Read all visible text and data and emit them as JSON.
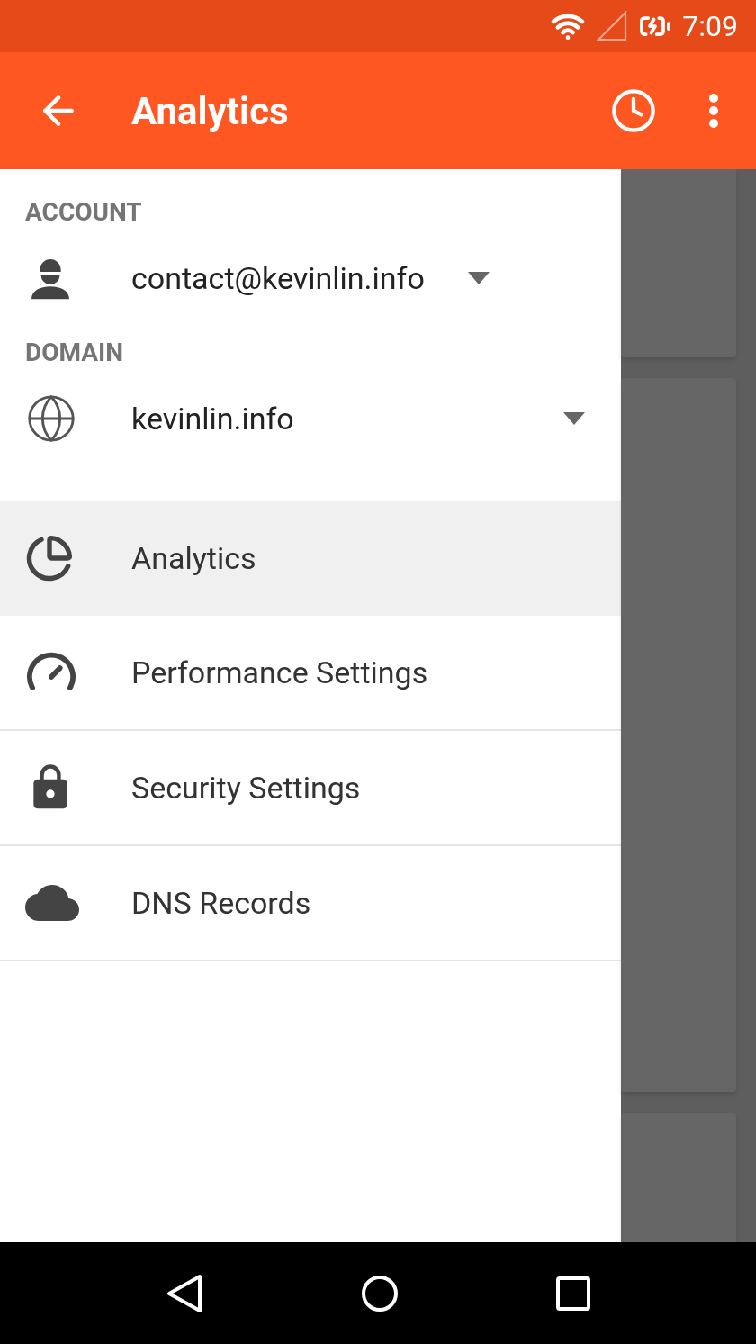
{
  "status_bar": {
    "time": "7:09"
  },
  "app_bar": {
    "title": "Analytics"
  },
  "drawer": {
    "sections": [
      {
        "kind": "account",
        "heading": "ACCOUNT",
        "value": "contact@kevinlin.info"
      },
      {
        "kind": "domain",
        "heading": "DOMAIN",
        "value": "kevinlin.info"
      }
    ],
    "items": [
      {
        "kind": "analytics",
        "label": "Analytics",
        "selected": true
      },
      {
        "kind": "performance",
        "label": "Performance Settings",
        "selected": false
      },
      {
        "kind": "security",
        "label": "Security Settings",
        "selected": false
      },
      {
        "kind": "dns",
        "label": "DNS Records",
        "selected": false
      }
    ]
  }
}
